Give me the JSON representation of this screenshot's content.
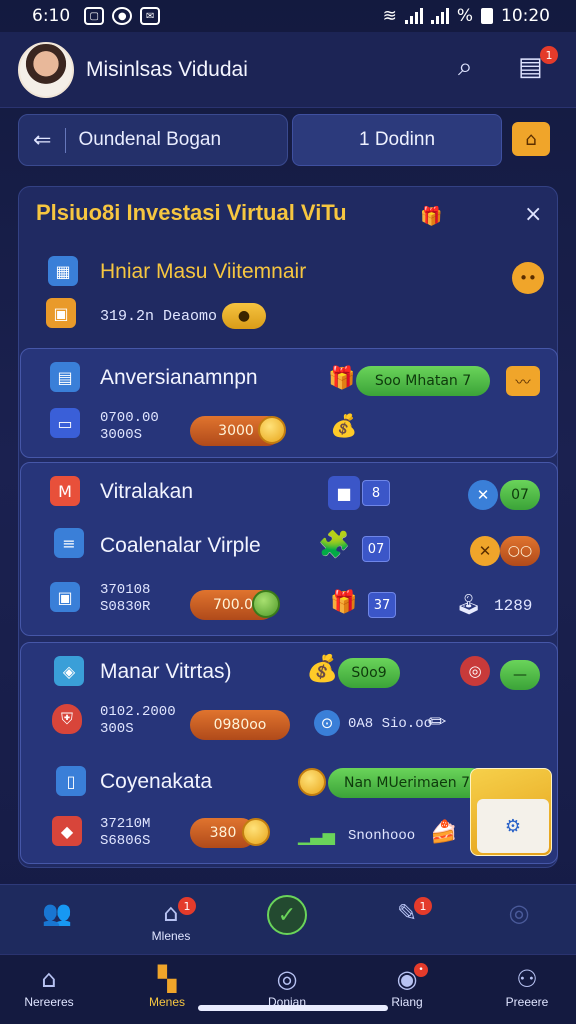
{
  "status": {
    "time_left": "6:10",
    "time_right": "10:20"
  },
  "header": {
    "title": "Misinlsas Vidudai",
    "notif_count": "1"
  },
  "search": {
    "label": "Oundenal Bogan",
    "filter": "1 Dodinn"
  },
  "panel": {
    "title": "Plsiuo8i Investasi Virtual ViTu",
    "close": "×"
  },
  "rows": {
    "r1": {
      "title": "Hniar Masu Viitemnair",
      "amount": "319.2n ",
      "sub": "Deaomo"
    },
    "r2": {
      "title": "Anversianamnpn",
      "line1": "0700.00",
      "line2": "3000S",
      "pill": "3000",
      "action": "Soo Mhatan 7"
    },
    "r3": {
      "title": "Vitralakan",
      "chip": "8",
      "pill_right": "07"
    },
    "r4": {
      "title": "Coalenalar Virple",
      "chip": "07",
      "line1": "370108",
      "line2": "S0830R",
      "pill": "700.0",
      "chip2": "37",
      "value": "1289"
    },
    "r5": {
      "title": "Manar Vitrtas)",
      "line1": "0102.2000",
      "line2": "300S",
      "pill": "0980oo",
      "coinpill": "S0o9",
      "note": "0A8 Sio.oo"
    },
    "r6": {
      "title": "Coyenakata",
      "line1": "37210M",
      "line2": "S6806S",
      "pill": "380",
      "action": "Nan MUerimaen 7",
      "note": "Snonhooo"
    }
  },
  "nav_top": [
    {
      "label": "",
      "icon": "group-icon"
    },
    {
      "label": "Mlenes",
      "icon": "home-icon",
      "badge": "1"
    },
    {
      "label": "",
      "icon": "check-icon"
    },
    {
      "label": "",
      "icon": "edit-icon",
      "badge": "1"
    },
    {
      "label": "",
      "icon": "compass-icon"
    }
  ],
  "nav_bottom": [
    {
      "label": "Nereeres",
      "icon": "home-icon"
    },
    {
      "label": "Menes",
      "icon": "grid-icon"
    },
    {
      "label": "Donian",
      "icon": "compass-icon"
    },
    {
      "label": "Riang",
      "icon": "bell-icon"
    },
    {
      "label": "Preeere",
      "icon": "user-icon"
    }
  ],
  "colors": {
    "accent": "#f6c640",
    "green": "#4fbf42",
    "orange": "#e0742e",
    "panel": "#202a62"
  }
}
